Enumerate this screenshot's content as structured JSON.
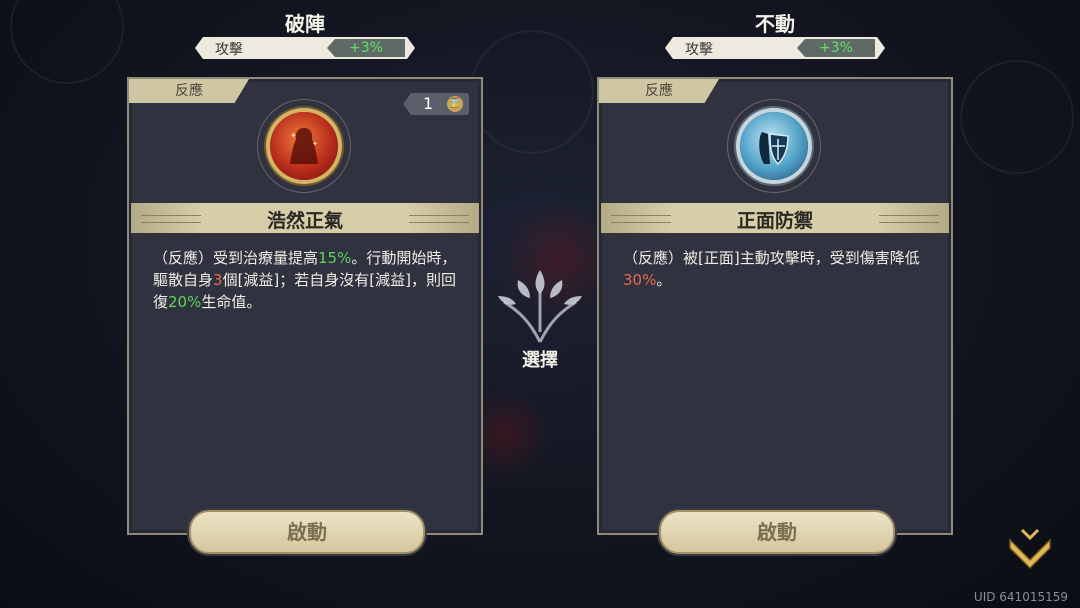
{
  "left": {
    "title": "破陣",
    "stat": {
      "label": "攻擊",
      "value": "+3%"
    },
    "tab": "反應",
    "cost": "1",
    "skill_name": "浩然正氣",
    "desc": {
      "p1": "（反應）受到治療量提高",
      "v1": "15%",
      "p2": "。行動開始時，驅散自身",
      "v2": "3",
      "p3": "個[減益]；若自身沒有[減益]，則回復",
      "v3": "20%",
      "p4": "生命值。"
    },
    "button": "啟動"
  },
  "right": {
    "title": "不動",
    "stat": {
      "label": "攻擊",
      "value": "+3%"
    },
    "tab": "反應",
    "skill_name": "正面防禦",
    "desc": {
      "p1": "（反應）被[正面]主動攻擊時，受到傷害降低",
      "v1": "30%",
      "p2": "。"
    },
    "button": "啟動"
  },
  "center": {
    "select_label": "選擇"
  },
  "footer": {
    "uid": "UID 641015159"
  },
  "colors": {
    "accent_green": "#5fd35a",
    "accent_red": "#e96a52",
    "gold": "#d6cda9"
  }
}
